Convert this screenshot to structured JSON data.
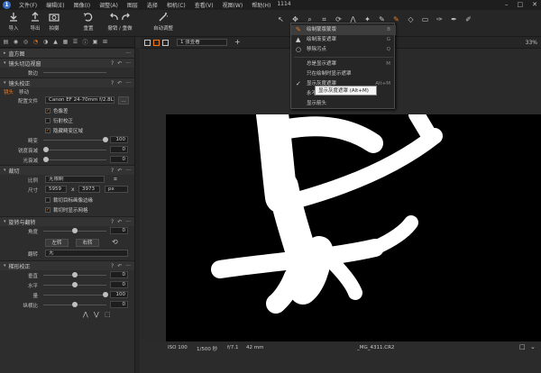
{
  "app": {
    "title": "1114",
    "menus": [
      "文件(F)",
      "编辑(E)",
      "图像(I)",
      "调整(A)",
      "图层",
      "选择",
      "相机(C)",
      "查看(V)",
      "视图(W)",
      "帮助(H)"
    ]
  },
  "toolbar": {
    "import": "导入",
    "export": "导出",
    "capture": "拍摄",
    "reset": "重置",
    "undo_redo": "撤销 / 重做",
    "auto_adjust": "自动调整"
  },
  "viewer_bar": {
    "view_mode": "1 张查看",
    "zoom": "33%"
  },
  "panels": {
    "histogram": "直方图",
    "lens_crop": "镜头切边视窗",
    "lens_crop_amount_label": "数边",
    "lens_correction": "镜头校正",
    "lens_subtabs": [
      "镜头",
      "移动"
    ],
    "profile_label": "配置文件",
    "profile_value": "Canon EF 24-70mm f/2.8L...",
    "chk_chromatic": "色像差",
    "chk_diffraction": "衍射校正",
    "chk_hide_distortion": "隐藏畸变区域",
    "distortion_label": "畸变",
    "distortion_value": "100",
    "sharpness_label": "锐度衰减",
    "sharpness_value": "0",
    "light_label": "光衰减",
    "light_value": "0",
    "crop": "裁切",
    "ratio_label": "比例",
    "ratio_value": "无限制",
    "size_label": "尺寸",
    "size_w": "5959",
    "size_x": "x",
    "size_h": "3973",
    "size_unit": "px",
    "chk_crop_outside": "裁切目标画像边缘",
    "chk_crop_grid": "裁切时显示网格",
    "rotate": "旋转与翻转",
    "angle_label": "角度",
    "angle_value": "0",
    "rotate_left": "左转",
    "rotate_right": "右转",
    "flip_label": "翻转",
    "flip_value": "无",
    "keystone": "梯形校正",
    "vertical_label": "垂直",
    "vertical_value": "0",
    "horizontal_label": "水平",
    "horizontal_value": "0",
    "amount_label": "量",
    "amount_value": "100",
    "aspect_label": "纵横比",
    "aspect_value": "0"
  },
  "mask_menu": {
    "items": [
      {
        "icon": "✎",
        "label": "绘制蒙版蒙版",
        "key": "B"
      },
      {
        "icon": "▲",
        "label": "绘制渐变遮罩",
        "key": "G"
      },
      {
        "icon": "○",
        "label": "移除污点",
        "key": "Q"
      },
      {
        "icon": "",
        "label": "总是显示遮罩",
        "key": "M"
      },
      {
        "icon": "",
        "label": "只在绘制时显示遮罩",
        "key": ""
      },
      {
        "icon": "✓",
        "label": "显示灰度遮罩",
        "key": "Alt+M"
      },
      {
        "icon": "",
        "label": "永不显示遮罩",
        "key": ""
      },
      {
        "icon": "",
        "label": "显示箭头",
        "key": ""
      }
    ],
    "tooltip": "显示灰度遮罩 (Alt+M)"
  },
  "status": {
    "iso": "ISO 100",
    "shutter": "1/500 秒",
    "aperture": "f/7.1",
    "focal": "42 mm",
    "filename": "_MG_4311.CR2"
  },
  "colors": {
    "accent": "#f07a1c",
    "canvas": "#000000",
    "mask": "#ffffff"
  }
}
